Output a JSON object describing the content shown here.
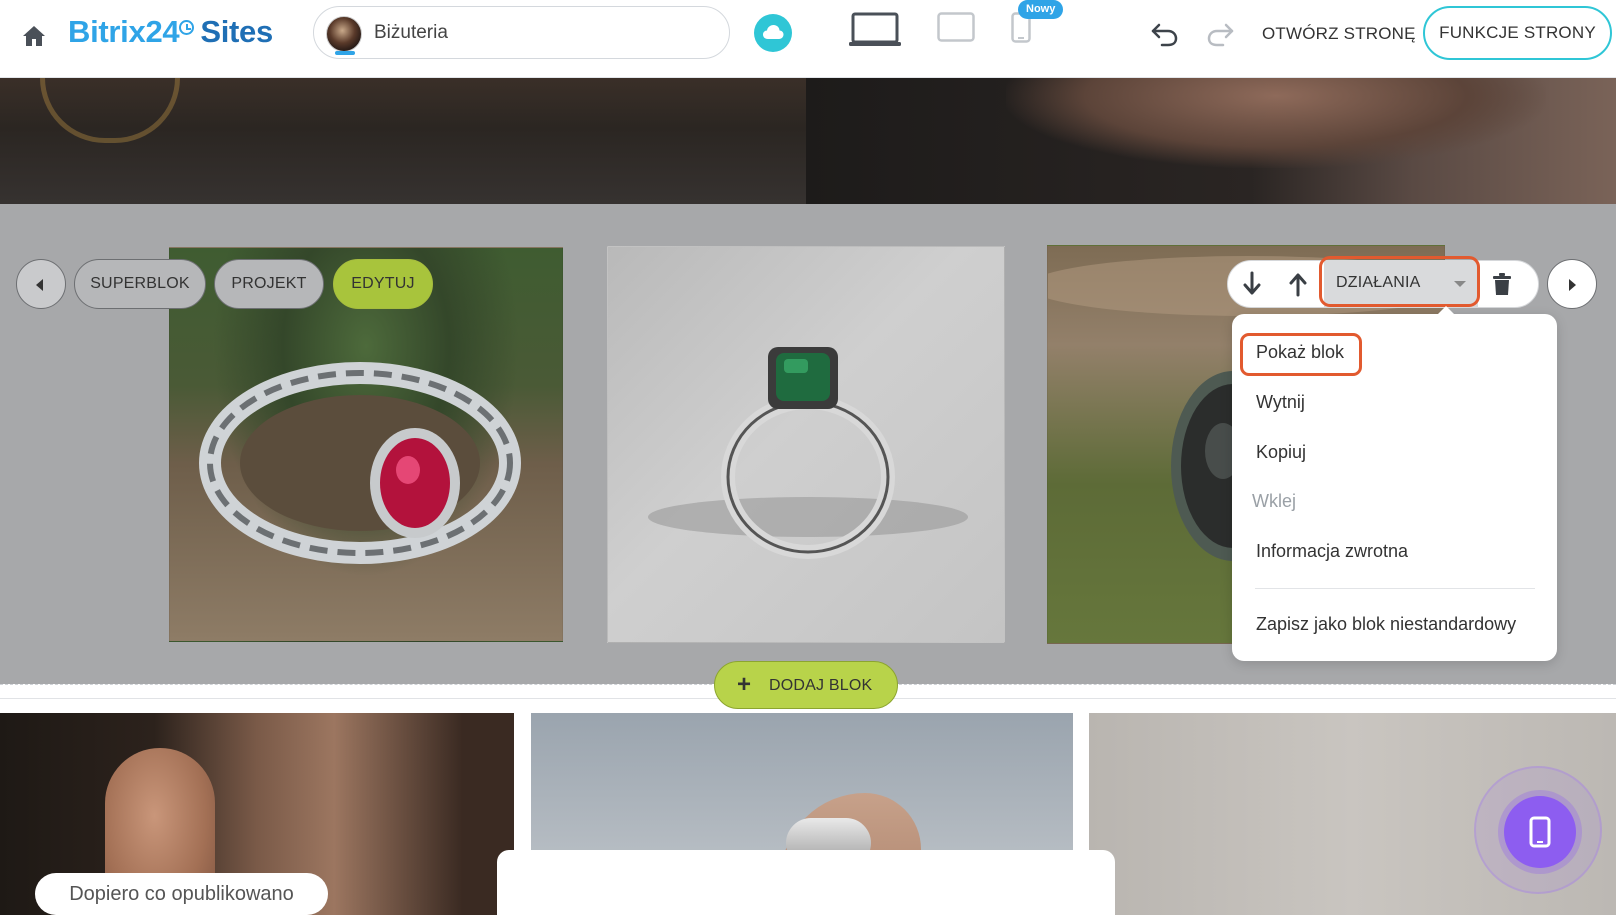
{
  "topbar": {
    "logo_main": "Bitrix24",
    "logo_sites": "Sites",
    "site_name": "Biżuteria",
    "new_badge": "Nowy",
    "open_page": "OTWÓRZ STRONĘ",
    "page_features": "FUNKCJE STRONY",
    "icons": [
      "home-icon",
      "cloud-icon",
      "desktop-icon",
      "tablet-icon",
      "mobile-icon",
      "undo-icon",
      "redo-icon"
    ]
  },
  "block_controls": {
    "superblock": "SUPERBLOK",
    "design": "PROJEKT",
    "edit": "EDYTUJ",
    "actions": "DZIAŁANIA"
  },
  "actions_menu": {
    "items": [
      {
        "label": "Pokaż blok",
        "enabled": true
      },
      {
        "label": "Wytnij",
        "enabled": true
      },
      {
        "label": "Kopiuj",
        "enabled": true
      },
      {
        "label": "Wklej",
        "enabled": false
      },
      {
        "label": "Informacja zwrotna",
        "enabled": true
      },
      {
        "label": "Zapisz jako blok niestandardowy",
        "enabled": true
      }
    ]
  },
  "add_block": "DODAJ BLOK",
  "status": {
    "published": "Dopiero co opublikowano"
  },
  "colors": {
    "accent": "#2fa4e7",
    "highlight": "#e25a2f",
    "edit_green": "#a8c43c",
    "mobile_preview": "#8d5df0"
  }
}
